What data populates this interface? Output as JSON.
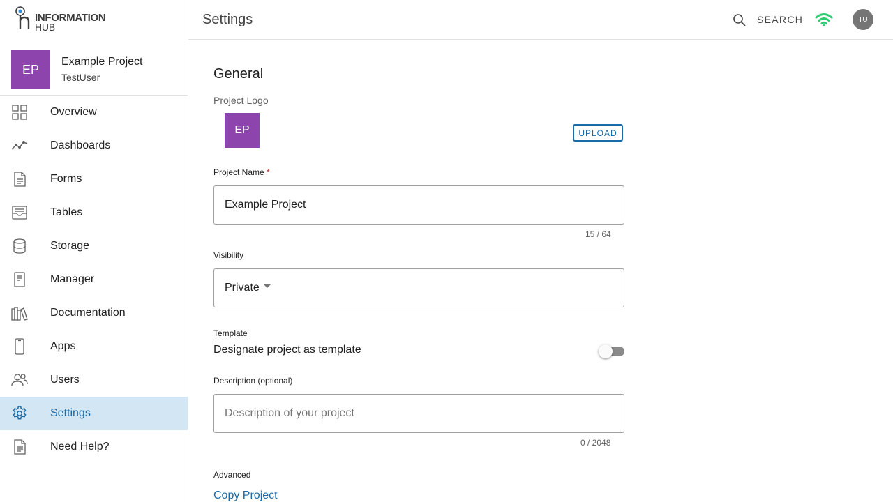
{
  "brand": {
    "line1": "INFORMATION",
    "line2": "HUB"
  },
  "project": {
    "initials": "EP",
    "name": "Example Project",
    "user": "TestUser"
  },
  "nav": [
    {
      "label": "Overview",
      "icon": "grid-icon"
    },
    {
      "label": "Dashboards",
      "icon": "chart-line-icon"
    },
    {
      "label": "Forms",
      "icon": "document-icon"
    },
    {
      "label": "Tables",
      "icon": "inbox-icon"
    },
    {
      "label": "Storage",
      "icon": "database-icon"
    },
    {
      "label": "Manager",
      "icon": "notepad-icon"
    },
    {
      "label": "Documentation",
      "icon": "books-icon"
    },
    {
      "label": "Apps",
      "icon": "phone-icon"
    },
    {
      "label": "Users",
      "icon": "users-icon"
    },
    {
      "label": "Settings",
      "icon": "gear-icon",
      "active": true
    },
    {
      "label": "Need Help?",
      "icon": "help-document-icon"
    }
  ],
  "header": {
    "title": "Settings",
    "search_label": "SEARCH",
    "user_initials": "TU"
  },
  "general": {
    "title": "General",
    "logo_label": "Project Logo",
    "logo_initials": "EP",
    "upload_label": "UPLOAD",
    "name_label": "Project Name",
    "required_mark": "*",
    "name_value": "Example Project",
    "name_counter": "15 / 64",
    "visibility_label": "Visibility",
    "visibility_value": "Private",
    "template_label": "Template",
    "template_text": "Designate project as template",
    "template_enabled": false,
    "description_label": "Description (optional)",
    "description_placeholder": "Description of your project",
    "description_counter": "0 / 2048",
    "advanced_label": "Advanced",
    "copy_label": "Copy Project"
  },
  "colors": {
    "accent": "#1a6aa8",
    "active_bg": "#d3e6f3",
    "project_avatar": "#8e44ad",
    "wifi": "#2ecc71"
  }
}
